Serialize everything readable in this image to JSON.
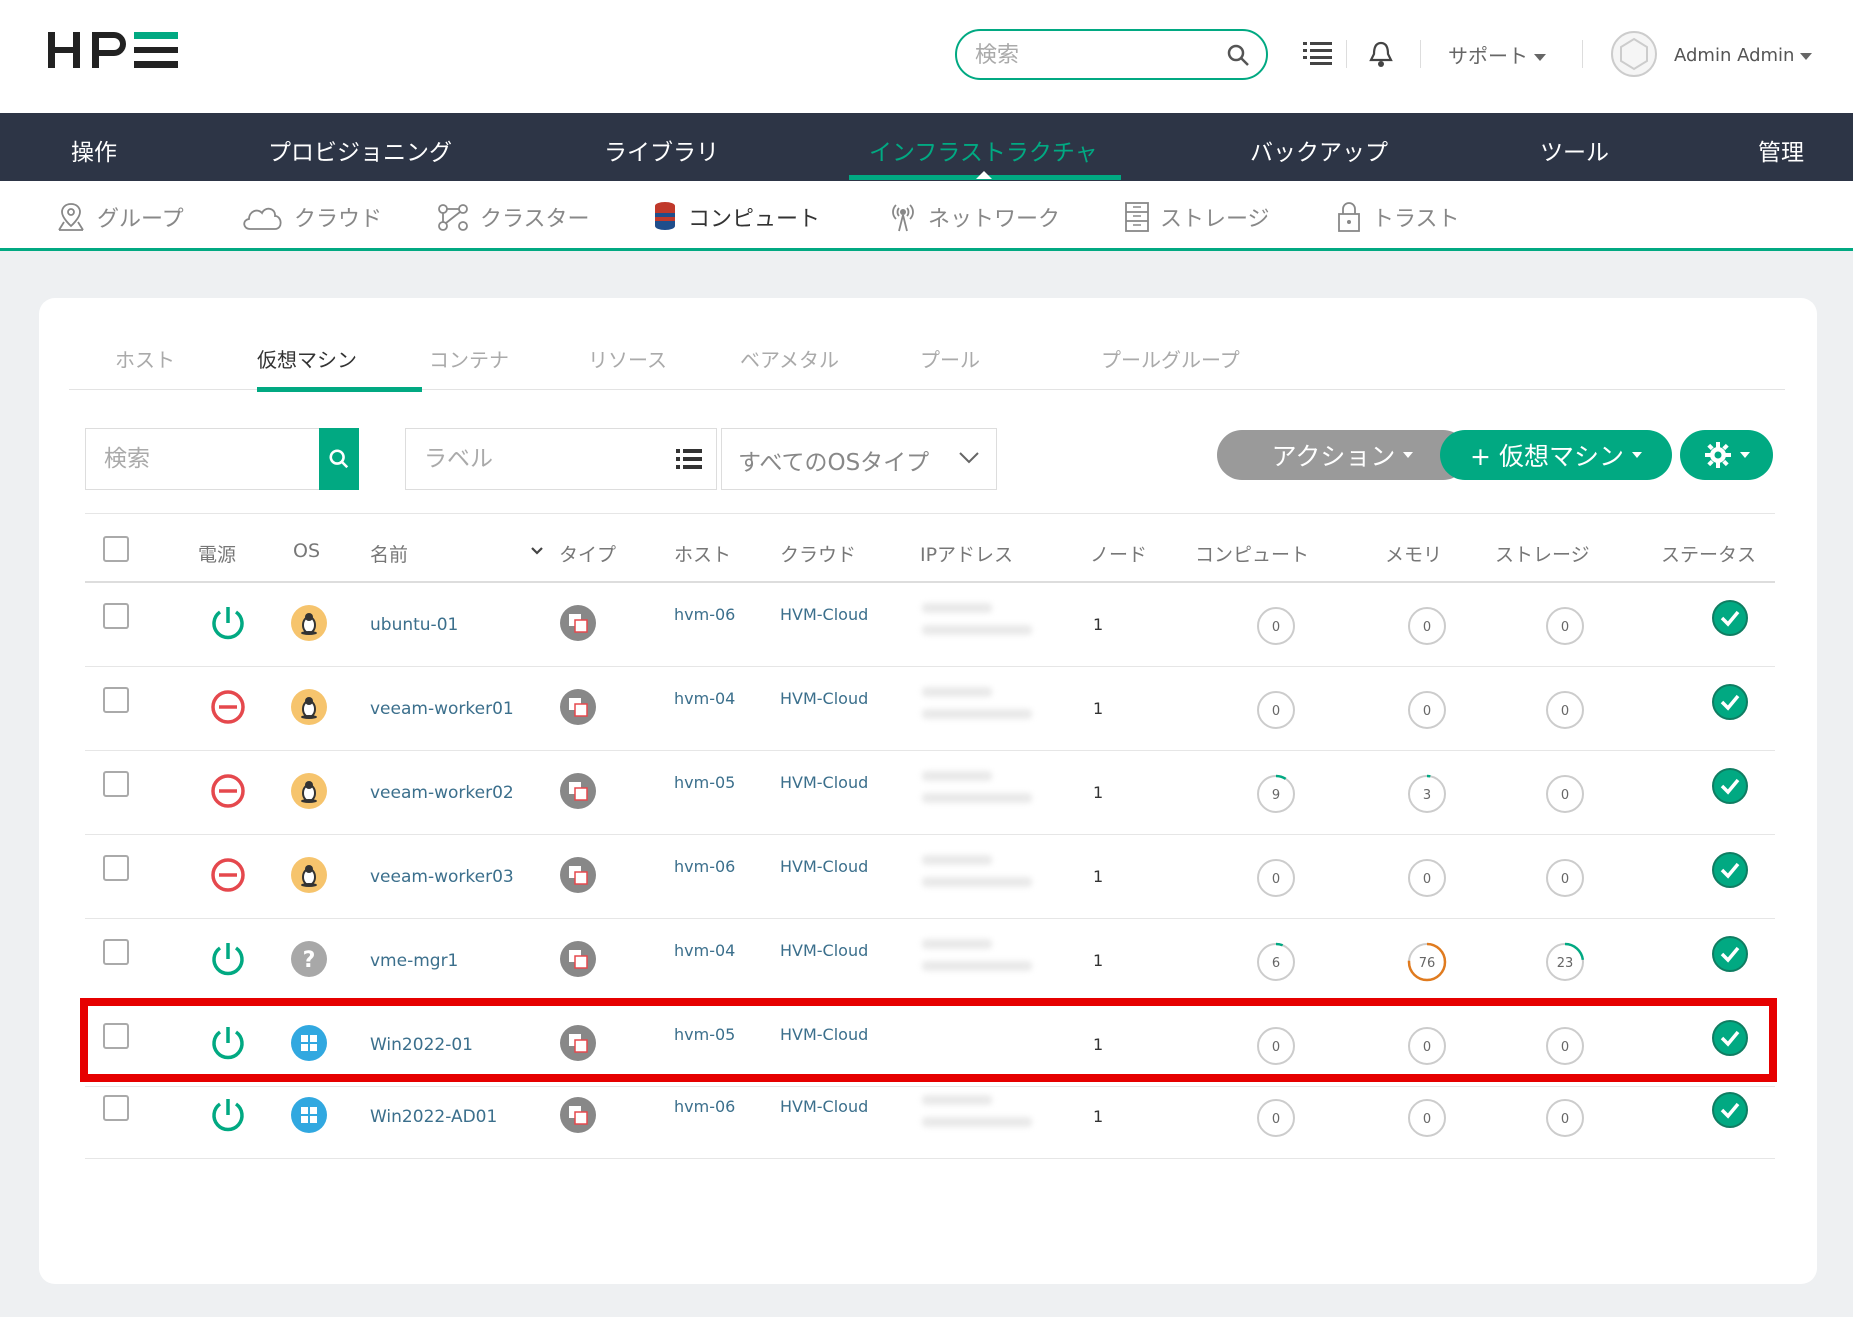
{
  "header": {
    "logo": "HPE",
    "search_placeholder": "検索",
    "support_label": "サポート",
    "user_label": "Admin Admin"
  },
  "main_nav": [
    {
      "label": "操作",
      "active": false
    },
    {
      "label": "プロビジョニング",
      "active": false
    },
    {
      "label": "ライブラリ",
      "active": false
    },
    {
      "label": "インフラストラクチャ",
      "active": true
    },
    {
      "label": "バックアップ",
      "active": false
    },
    {
      "label": "ツール",
      "active": false
    },
    {
      "label": "管理",
      "active": false
    }
  ],
  "sub_nav": [
    {
      "label": "グループ",
      "icon": "map-pin-icon",
      "active": false
    },
    {
      "label": "クラウド",
      "icon": "cloud-icon",
      "active": false
    },
    {
      "label": "クラスター",
      "icon": "cluster-icon",
      "active": false
    },
    {
      "label": "コンピュート",
      "icon": "database-icon",
      "active": true
    },
    {
      "label": "ネットワーク",
      "icon": "antenna-icon",
      "active": false
    },
    {
      "label": "ストレージ",
      "icon": "storage-icon",
      "active": false
    },
    {
      "label": "トラスト",
      "icon": "lock-icon",
      "active": false
    }
  ],
  "tabs": [
    {
      "label": "ホスト",
      "active": false
    },
    {
      "label": "仮想マシン",
      "active": true
    },
    {
      "label": "コンテナ",
      "active": false
    },
    {
      "label": "リソース",
      "active": false
    },
    {
      "label": "ベアメタル",
      "active": false
    },
    {
      "label": "プール",
      "active": false
    },
    {
      "label": "プールグループ",
      "active": false
    }
  ],
  "filters": {
    "search_placeholder": "検索",
    "label_placeholder": "ラベル",
    "os_select": "すべてのOSタイプ"
  },
  "buttons": {
    "action": "アクション",
    "add_vm": "+ 仮想マシン"
  },
  "columns": {
    "power": "電源",
    "os": "OS",
    "name": "名前",
    "type": "タイプ",
    "host": "ホスト",
    "cloud": "クラウド",
    "ip": "IPアドレス",
    "node": "ノード",
    "compute": "コンピュート",
    "memory": "メモリ",
    "storage": "ストレージ",
    "status": "ステータス"
  },
  "rows": [
    {
      "power": "on",
      "os": "linux",
      "name": "ubuntu-01",
      "host": "hvm-06",
      "cloud": "HVM-Cloud",
      "ip_blurred": true,
      "node": "1",
      "compute": 0,
      "memory": 0,
      "storage": 0,
      "status": "ok"
    },
    {
      "power": "off",
      "os": "linux",
      "name": "veeam-worker01",
      "host": "hvm-04",
      "cloud": "HVM-Cloud",
      "ip_blurred": true,
      "node": "1",
      "compute": 0,
      "memory": 0,
      "storage": 0,
      "status": "ok"
    },
    {
      "power": "off",
      "os": "linux",
      "name": "veeam-worker02",
      "host": "hvm-05",
      "cloud": "HVM-Cloud",
      "ip_blurred": true,
      "node": "1",
      "compute": 9,
      "memory": 3,
      "storage": 0,
      "status": "ok"
    },
    {
      "power": "off",
      "os": "linux",
      "name": "veeam-worker03",
      "host": "hvm-06",
      "cloud": "HVM-Cloud",
      "ip_blurred": true,
      "node": "1",
      "compute": 0,
      "memory": 0,
      "storage": 0,
      "status": "ok"
    },
    {
      "power": "on",
      "os": "unknown",
      "name": "vme-mgr1",
      "host": "hvm-04",
      "cloud": "HVM-Cloud",
      "ip_blurred": true,
      "node": "1",
      "compute": 6,
      "memory": 76,
      "storage": 23,
      "status": "ok"
    },
    {
      "power": "on",
      "os": "windows",
      "name": "Win2022-01",
      "host": "hvm-05",
      "cloud": "HVM-Cloud",
      "ip_blurred": false,
      "node": "1",
      "compute": 0,
      "memory": 0,
      "storage": 0,
      "status": "ok"
    },
    {
      "power": "on",
      "os": "windows",
      "name": "Win2022-AD01",
      "host": "hvm-06",
      "cloud": "HVM-Cloud",
      "ip_blurred": true,
      "node": "1",
      "compute": 0,
      "memory": 0,
      "storage": 0,
      "status": "ok"
    }
  ],
  "colors": {
    "accent": "#01a982",
    "nav_bg": "#2d3546",
    "power_on": "#01a982",
    "power_off": "#e5484d",
    "linux_os": "#f6c46d",
    "windows_os": "#31a8e0",
    "unknown_os": "#a8a8a8",
    "memory_ring_warn": "#e07b1f",
    "highlight": "#e60000"
  }
}
